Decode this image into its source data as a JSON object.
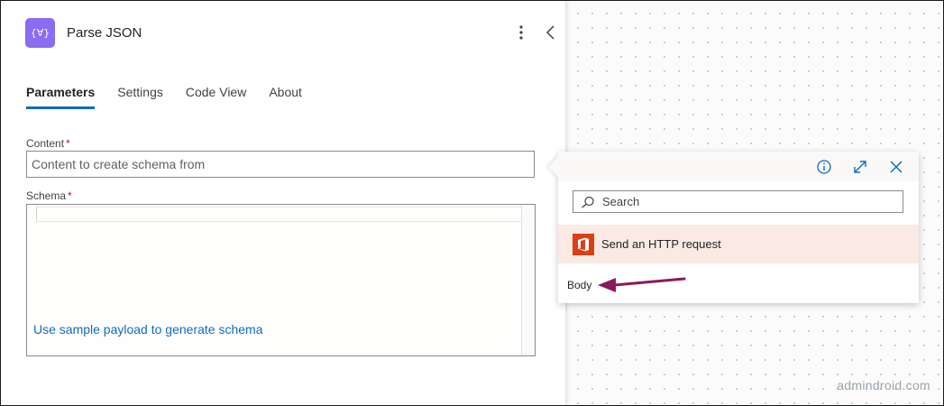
{
  "panel": {
    "title": "Parse JSON",
    "action_icon_glyph": "{∀}",
    "icons": {
      "more": "more-vertical-icon",
      "collapse": "chevron-left-icon"
    }
  },
  "tabs": [
    {
      "label": "Parameters",
      "active": true
    },
    {
      "label": "Settings",
      "active": false
    },
    {
      "label": "Code View",
      "active": false
    },
    {
      "label": "About",
      "active": false
    }
  ],
  "fields": {
    "content": {
      "label": "Content",
      "required_mark": "*",
      "placeholder": "Content to create schema from",
      "value": ""
    },
    "schema": {
      "label": "Schema",
      "required_mark": "*",
      "sample_link": "Use sample payload to generate schema"
    }
  },
  "dynamic_content_popup": {
    "header_icons": [
      "info-icon",
      "expand-icon",
      "close-icon"
    ],
    "search_placeholder": "Search",
    "connector": {
      "name": "Send an HTTP request",
      "icon": "office-365-icon",
      "color": "#dc3e15"
    },
    "tokens": [
      {
        "label": "Body"
      }
    ]
  },
  "annotation": {
    "arrow_color": "#8b1a5c"
  },
  "watermark": "admindroid.com",
  "colors": {
    "accent": "#0f6cbd",
    "action_icon": "#8c6cf0",
    "required": "#c50f1f",
    "connector_row_bg": "#fbe9e4"
  }
}
